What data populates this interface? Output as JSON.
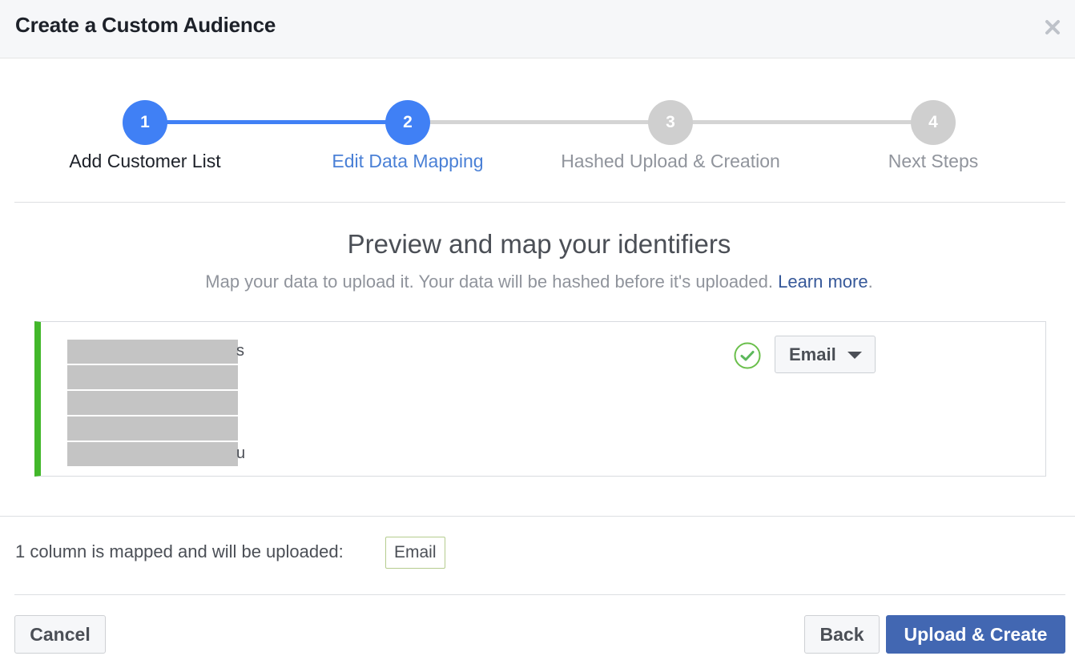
{
  "dialog": {
    "title": "Create a Custom Audience",
    "close_icon": "close-icon"
  },
  "stepper": {
    "steps": [
      {
        "number": "1",
        "label": "Add Customer List",
        "state": "completed"
      },
      {
        "number": "2",
        "label": "Edit Data Mapping",
        "state": "active"
      },
      {
        "number": "3",
        "label": "Hashed Upload & Creation",
        "state": "pending"
      },
      {
        "number": "4",
        "label": "Next Steps",
        "state": "pending"
      }
    ],
    "colors": {
      "active": "#4080f5",
      "pending": "#cccccc",
      "active_label": "#4a80d6",
      "completed_label": "#1d2129",
      "pending_label": "#90949c"
    }
  },
  "main": {
    "title": "Preview and map your identifiers",
    "subtitle": "Map your data to upload it. Your data will be hashed before it's uploaded.",
    "learn_more": "Learn more",
    "subtitle_end": "."
  },
  "mapping_row": {
    "preview_values": [
      {
        "visible_tail": "s",
        "redacted": true
      },
      {
        "visible_tail": "",
        "redacted": true
      },
      {
        "visible_tail": "",
        "redacted": true
      },
      {
        "visible_tail": "",
        "redacted": true
      },
      {
        "visible_tail": "u",
        "redacted": true
      }
    ],
    "status_icon": "check-circle-icon",
    "selected_type": "Email",
    "accent_color": "#42b72a"
  },
  "summary": {
    "text": "1 column is mapped and will be uploaded:",
    "mapped_columns": [
      "Email"
    ]
  },
  "footer": {
    "cancel_label": "Cancel",
    "back_label": "Back",
    "primary_label": "Upload & Create",
    "primary_color": "#4267b2"
  }
}
